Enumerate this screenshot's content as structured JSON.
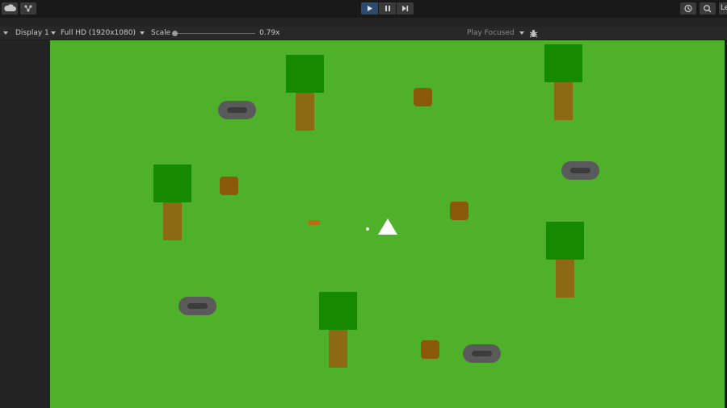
{
  "toolbar": {
    "left_icons": [
      "cloud-icon",
      "collab-icon"
    ],
    "playmode": {
      "play_state": "active",
      "buttons": [
        "play-icon",
        "pause-icon",
        "step-icon"
      ]
    },
    "right_icons": [
      "history-icon",
      "search-icon"
    ],
    "account_label": "Le"
  },
  "gamebar": {
    "display": "Display 1",
    "resolution": "Full HD (1920x1080)",
    "scale_label": "Scale",
    "scale_value": "0.79x",
    "play_mode": "Play Focused",
    "bug_icon": "bug-icon"
  },
  "scene": {
    "background_color": "#4fb12a",
    "tree_foliage_color": "#158a00",
    "tree_trunk_color": "#8b6a12",
    "bush_color": "#8a5a0a",
    "rock_color": "#5a5a5a",
    "player_color": "#ffffff"
  }
}
